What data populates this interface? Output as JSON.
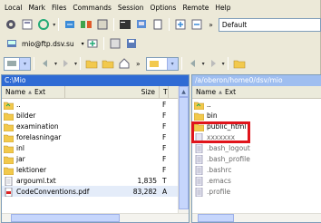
{
  "menu": [
    "Local",
    "Mark",
    "Files",
    "Commands",
    "Session",
    "Options",
    "Remote",
    "Help"
  ],
  "toolbar1": {
    "transfer_setting": "Default",
    "overflow": "»"
  },
  "toolbar2": {
    "session": "mio@ftp.dsv.su",
    "session_arrow": "▾"
  },
  "toolbar3": {
    "overflow": "»"
  },
  "left_panel": {
    "path": "C:\\Mio",
    "columns": [
      "Name",
      "Ext",
      "Size",
      "T"
    ],
    "sort_arrow": "▲",
    "rows": [
      {
        "name": "..",
        "ext": "",
        "size": "",
        "type": "F"
      },
      {
        "name": "bilder",
        "ext": "",
        "size": "",
        "type": "F"
      },
      {
        "name": "examination",
        "ext": "",
        "size": "",
        "type": "F"
      },
      {
        "name": "forelasningar",
        "ext": "",
        "size": "",
        "type": "F"
      },
      {
        "name": "inl",
        "ext": "",
        "size": "",
        "type": "F"
      },
      {
        "name": "jar",
        "ext": "",
        "size": "",
        "type": "F"
      },
      {
        "name": "lektioner",
        "ext": "",
        "size": "",
        "type": "F"
      },
      {
        "name": "argouml.txt",
        "ext": "",
        "size": "1,835",
        "type": "T"
      },
      {
        "name": "CodeConventions.pdf",
        "ext": "",
        "size": "83,282",
        "type": "A"
      }
    ]
  },
  "right_panel": {
    "path": "/a/oberon/home0/dsv/mio",
    "columns": [
      "Name",
      "Ext"
    ],
    "sort_arrow": "▲",
    "rows": [
      {
        "name": "..",
        "greyed": false
      },
      {
        "name": "bin",
        "greyed": false
      },
      {
        "name": "public_html",
        "greyed": false
      },
      {
        "name": "xxxxxxx",
        "greyed": true
      },
      {
        "name": ".bash_logout",
        "greyed": true
      },
      {
        "name": ".bash_profile",
        "greyed": true
      },
      {
        "name": ".bashrc",
        "greyed": true
      },
      {
        "name": ".emacs",
        "greyed": true
      },
      {
        "name": ".profile",
        "greyed": true
      }
    ]
  },
  "colors": {
    "highlight": "#e0141b",
    "folder": "#f2c94c",
    "active_path": "#2f6bd4"
  }
}
